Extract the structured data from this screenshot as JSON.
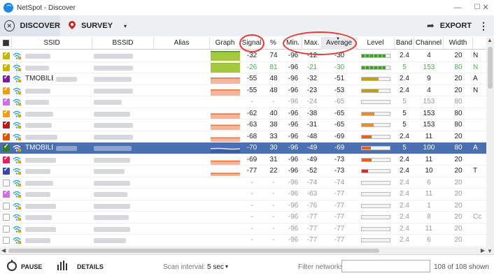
{
  "window": {
    "title": "NetSpot - Discover",
    "minimize": "—",
    "maximize": "☐",
    "close": "✕"
  },
  "toolbar": {
    "discover_label": "DISCOVER",
    "survey_label": "SURVEY",
    "survey_caret": "▾",
    "export_label": "EXPORT",
    "more_label": "⋮"
  },
  "columns": {
    "ssid": "SSID",
    "bssid": "BSSID",
    "alias": "Alias",
    "graph": "Graph",
    "signal": "Signal",
    "percent": "%",
    "min": "Min.",
    "max": "Max.",
    "average": "Average",
    "level": "Level",
    "band": "Band",
    "channel": "Channel",
    "width": "Width"
  },
  "colors": {
    "selected_row": "#4a6fb3",
    "annotation": "#e53935",
    "accent": "#1e88e5"
  },
  "rows": [
    {
      "checked": true,
      "check_color": "#c8b400",
      "ssid": "",
      "signal": "-32",
      "percent": "74",
      "min": "-96",
      "max": "-12",
      "average": "-30",
      "level": 0.85,
      "level_color": "#3aa02a",
      "band": "2.4",
      "channel": "4",
      "width": "20",
      "extra": "N",
      "graph": "green",
      "selected": false,
      "dim": false
    },
    {
      "checked": true,
      "check_color": "#c8b400",
      "ssid": "",
      "signal": "-26",
      "percent": "81",
      "min": "-96",
      "max": "-21",
      "average": "-30",
      "level": 0.85,
      "level_color": "#3aa02a",
      "band": "5",
      "channel": "153",
      "width": "80",
      "extra": "N",
      "graph": "green",
      "selected": false,
      "dim": false,
      "green_text": true
    },
    {
      "checked": true,
      "check_color": "#7b1fa2",
      "ssid": "TMOBILE",
      "signal": "-55",
      "percent": "48",
      "min": "-96",
      "max": "-32",
      "average": "-51",
      "level": 0.6,
      "level_color": "#b8a21a",
      "band": "2.4",
      "channel": "9",
      "width": "20",
      "extra": "A",
      "graph": "orange",
      "selected": false,
      "dim": false
    },
    {
      "checked": true,
      "check_color": "#f39c12",
      "ssid": "",
      "signal": "-55",
      "percent": "48",
      "min": "-96",
      "max": "-23",
      "average": "-53",
      "level": 0.6,
      "level_color": "#b8a21a",
      "band": "2.4",
      "channel": "4",
      "width": "20",
      "extra": "N",
      "graph": "orange",
      "selected": false,
      "dim": false
    },
    {
      "checked": true,
      "check_color": "#d070e0",
      "ssid": "",
      "signal": "-",
      "percent": "-",
      "min": "-96",
      "max": "-24",
      "average": "-65",
      "level": 0.0,
      "level_color": "#f08a24",
      "band": "5",
      "channel": "153",
      "width": "80",
      "extra": "",
      "graph": "none",
      "selected": false,
      "dim": true
    },
    {
      "checked": true,
      "check_color": "#f39c12",
      "ssid": "",
      "signal": "-62",
      "percent": "40",
      "min": "-96",
      "max": "-38",
      "average": "-65",
      "level": 0.45,
      "level_color": "#f08a24",
      "band": "5",
      "channel": "153",
      "width": "80",
      "extra": "",
      "graph": "orange",
      "selected": false,
      "dim": false
    },
    {
      "checked": true,
      "check_color": "#b71c1c",
      "ssid": "",
      "signal": "-63",
      "percent": "38",
      "min": "-96",
      "max": "-31",
      "average": "-65",
      "level": 0.42,
      "level_color": "#f08a24",
      "band": "5",
      "channel": "153",
      "width": "80",
      "extra": "",
      "graph": "orange",
      "selected": false,
      "dim": false
    },
    {
      "checked": true,
      "check_color": "#e65100",
      "ssid": "",
      "signal": "-68",
      "percent": "33",
      "min": "-96",
      "max": "-48",
      "average": "-69",
      "level": 0.35,
      "level_color": "#e8601c",
      "band": "2.4",
      "channel": "11",
      "width": "20",
      "extra": "",
      "graph": "orange",
      "selected": false,
      "dim": false
    },
    {
      "checked": true,
      "check_color": "#2e7d32",
      "ssid": "TMOBILE",
      "signal": "-70",
      "percent": "30",
      "min": "-96",
      "max": "-49",
      "average": "-69",
      "level": 0.32,
      "level_color": "#e8601c",
      "band": "5",
      "channel": "100",
      "width": "80",
      "extra": "A",
      "graph": "blue",
      "selected": true,
      "dim": false
    },
    {
      "checked": true,
      "check_color": "#e91e63",
      "ssid": "",
      "signal": "-69",
      "percent": "31",
      "min": "-96",
      "max": "-49",
      "average": "-73",
      "level": 0.34,
      "level_color": "#e8601c",
      "band": "2.4",
      "channel": "11",
      "width": "20",
      "extra": "",
      "graph": "orange",
      "selected": false,
      "dim": false
    },
    {
      "checked": true,
      "check_color": "#3949ab",
      "ssid": "",
      "signal": "-77",
      "percent": "22",
      "min": "-96",
      "max": "-52",
      "average": "-73",
      "level": 0.22,
      "level_color": "#d32f2f",
      "band": "2.4",
      "channel": "10",
      "width": "20",
      "extra": "T",
      "graph": "orange",
      "selected": false,
      "dim": false
    },
    {
      "checked": false,
      "check_color": "",
      "ssid": "",
      "signal": "-",
      "percent": "-",
      "min": "-96",
      "max": "-74",
      "average": "-74",
      "level": 0.0,
      "level_color": "#d32f2f",
      "band": "2.4",
      "channel": "6",
      "width": "20",
      "extra": "",
      "graph": "none",
      "selected": false,
      "dim": true
    },
    {
      "checked": true,
      "check_color": "#d070e0",
      "ssid": "",
      "signal": "-",
      "percent": "-",
      "min": "-96",
      "max": "-63",
      "average": "-77",
      "level": 0.0,
      "level_color": "#d32f2f",
      "band": "2.4",
      "channel": "11",
      "width": "20",
      "extra": "",
      "graph": "none",
      "selected": false,
      "dim": true
    },
    {
      "checked": false,
      "check_color": "",
      "ssid": "",
      "signal": "-",
      "percent": "-",
      "min": "-96",
      "max": "-76",
      "average": "-77",
      "level": 0.0,
      "level_color": "#d32f2f",
      "band": "2.4",
      "channel": "1",
      "width": "20",
      "extra": "",
      "graph": "none",
      "selected": false,
      "dim": true
    },
    {
      "checked": false,
      "check_color": "",
      "ssid": "",
      "signal": "-",
      "percent": "-",
      "min": "-96",
      "max": "-77",
      "average": "-77",
      "level": 0.0,
      "level_color": "#d32f2f",
      "band": "2.4",
      "channel": "8",
      "width": "20",
      "extra": "Cc",
      "graph": "none",
      "selected": false,
      "dim": true
    },
    {
      "checked": false,
      "check_color": "",
      "ssid": "",
      "signal": "-",
      "percent": "-",
      "min": "-96",
      "max": "-77",
      "average": "-77",
      "level": 0.0,
      "level_color": "#d32f2f",
      "band": "2.4",
      "channel": "11",
      "width": "20",
      "extra": "",
      "graph": "none",
      "selected": false,
      "dim": true
    },
    {
      "checked": false,
      "check_color": "",
      "ssid": "",
      "signal": "-",
      "percent": "-",
      "min": "-96",
      "max": "-77",
      "average": "-77",
      "level": 0.0,
      "level_color": "#d32f2f",
      "band": "2.4",
      "channel": "6",
      "width": "20",
      "extra": "",
      "graph": "none",
      "selected": false,
      "dim": true
    }
  ],
  "statusbar": {
    "pause_label": "PAUSE",
    "details_label": "DETAILS",
    "scan_interval_label": "Scan interval:",
    "scan_interval_value": "5 sec",
    "scan_caret": "▾",
    "filter_label": "Filter networks:",
    "filter_value": "",
    "count_label": "108 of 108 shown"
  }
}
